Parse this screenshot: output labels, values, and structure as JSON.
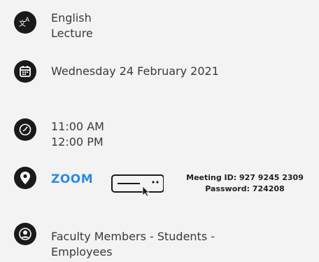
{
  "language": {
    "line1": "English",
    "line2": "Lecture"
  },
  "date": {
    "text": "Wednesday 24 February 2021"
  },
  "time": {
    "start": "11:00 AM",
    "end": "12:00 PM"
  },
  "location": {
    "link_label": "ZOOM",
    "meeting_id": "Meeting ID: 927 9245 2309",
    "password": "Password: 724208"
  },
  "audience": {
    "line1": "Faculty Members - Students -",
    "line2": "Employees"
  },
  "icons": [
    "translate-icon",
    "calendar-icon",
    "clock-icon",
    "location-pin-icon",
    "user-icon",
    "join-meeting-icon"
  ]
}
